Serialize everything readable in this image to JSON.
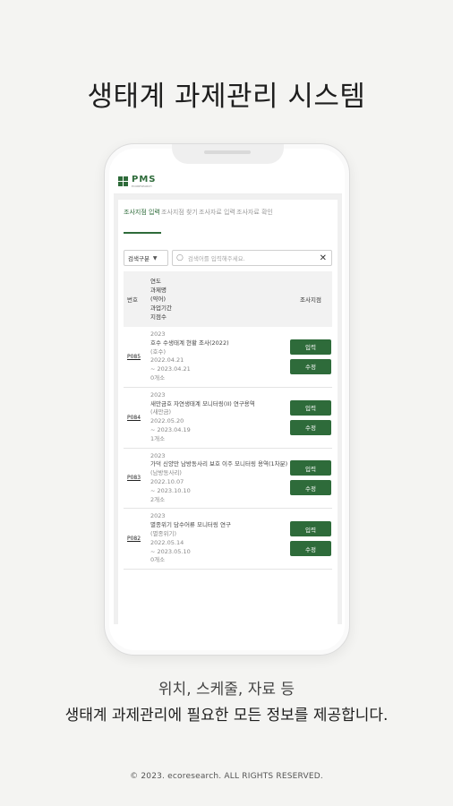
{
  "headline": "생태계 과제관리 시스템",
  "app": {
    "logo_text": "PMS",
    "logo_sub": "ECORESEARCH"
  },
  "tabs": [
    {
      "label": "조사지점 입력"
    },
    {
      "label": "조사지점 찾기"
    },
    {
      "label": "조사자료 입력"
    },
    {
      "label": "조사자료 확인"
    }
  ],
  "search": {
    "select_value": "검색구분",
    "placeholder": "검색어를 입력해주세요."
  },
  "table": {
    "header_no": "번호",
    "header_info": [
      "연도",
      "과제명",
      "(약어)",
      "과업기간",
      "지점수"
    ],
    "header_action": "조사지점"
  },
  "rows": [
    {
      "no": "P085",
      "year": "2023",
      "name": "호수 수생태계 현황 조사(2022)",
      "abbr": "(호수)",
      "start": "2022.04.21",
      "end": "~ 2023.04.21",
      "count": "0개소",
      "btn_input": "입력",
      "btn_edit": "수정"
    },
    {
      "no": "P084",
      "year": "2023",
      "name": "새만금호 자연생태계 모니터링(II) 연구용역",
      "abbr": "(새만금)",
      "start": "2022.05.20",
      "end": "~ 2023.04.19",
      "count": "1개소",
      "btn_input": "입력",
      "btn_edit": "수정"
    },
    {
      "no": "P083",
      "year": "2023",
      "name": "가덕 신양만 남방동사리 보호 이주 모니터링 용역(1차분)",
      "abbr": "(남방동사리)",
      "start": "2022.10.07",
      "end": "~ 2023.10.10",
      "count": "2개소",
      "btn_input": "입력",
      "btn_edit": "수정"
    },
    {
      "no": "P082",
      "year": "2023",
      "name": "멸종위기 담수어류 모니터링 연구",
      "abbr": "(멸종위기)",
      "start": "2022.05.14",
      "end": "~ 2023.05.10",
      "count": "0개소",
      "btn_input": "입력",
      "btn_edit": "수정"
    }
  ],
  "subtitle_1": "위치, 스케줄, 자료 등",
  "subtitle_2": "생태계 과제관리에 필요한 모든 정보를 제공합니다.",
  "copyright": "© 2023. ecoresearch. ALL RIGHTS RESERVED.",
  "colors": {
    "accent": "#2e6b3a",
    "background": "#f4f4f2"
  }
}
